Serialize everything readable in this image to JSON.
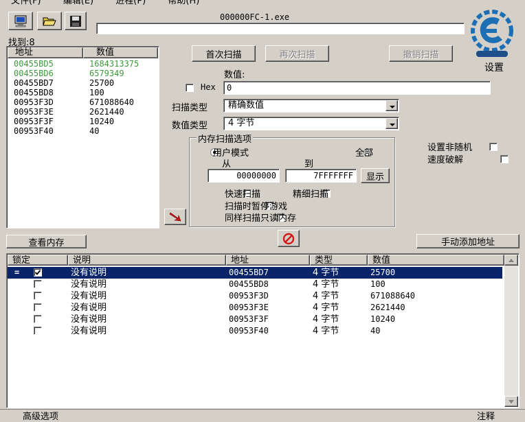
{
  "menu": [
    "文件(F)",
    "编辑(E)",
    "进程(P)",
    "帮助(H)"
  ],
  "process_name": "000000FC-1.exe",
  "found_label": "找到:8",
  "found_list": {
    "headers": [
      "地址",
      "数值"
    ],
    "rows": [
      {
        "address": "00455BD5",
        "value": "1684313375",
        "changed": true
      },
      {
        "address": "00455BD6",
        "value": "6579349",
        "changed": true
      },
      {
        "address": "00455BD7",
        "value": "25700",
        "changed": false
      },
      {
        "address": "00455BD8",
        "value": "100",
        "changed": false
      },
      {
        "address": "00953F3D",
        "value": "671088640",
        "changed": false
      },
      {
        "address": "00953F3E",
        "value": "2621440",
        "changed": false
      },
      {
        "address": "00953F3F",
        "value": "10240",
        "changed": false
      },
      {
        "address": "00953F40",
        "value": "40",
        "changed": false
      }
    ]
  },
  "scan": {
    "first_scan": "首次扫描",
    "next_scan": "再次扫描",
    "undo_scan": "撤销扫描",
    "settings": "设置",
    "value_label": "数值:",
    "hex_label": "Hex",
    "value_input": "0",
    "scan_type_label": "扫描类型",
    "scan_type_value": "精确数值",
    "value_type_label": "数值类型",
    "value_type_value": "4 字节"
  },
  "memory_options": {
    "title": "内存扫描选项",
    "user_mode": "用户模式",
    "all": "全部",
    "from_label": "从",
    "to_label": "到",
    "from_value": "00000000",
    "to_value": "7FFFFFFF",
    "show_button": "显示",
    "fast_scan": "快速扫描",
    "fine_scan": "精细扫描",
    "pause_game": "扫描时暂停游戏",
    "readonly_memory": "同样扫描只读内存"
  },
  "side_options": {
    "no_random": "设置非随机",
    "speedhack": "速度破解"
  },
  "view_memory": "查看内存",
  "add_address": "手动添加地址",
  "cheat_table": {
    "headers": [
      "锁定",
      "说明",
      "地址",
      "类型",
      "数值"
    ],
    "rows": [
      {
        "locked": true,
        "frozen_mark": "=",
        "desc": "没有说明",
        "address": "00455BD7",
        "type": "4 字节",
        "value": "25700",
        "selected": true
      },
      {
        "locked": false,
        "frozen_mark": "",
        "desc": "没有说明",
        "address": "00455BD8",
        "type": "4 字节",
        "value": "100",
        "selected": false
      },
      {
        "locked": false,
        "frozen_mark": "",
        "desc": "没有说明",
        "address": "00953F3D",
        "type": "4 字节",
        "value": "671088640",
        "selected": false
      },
      {
        "locked": false,
        "frozen_mark": "",
        "desc": "没有说明",
        "address": "00953F3E",
        "type": "4 字节",
        "value": "2621440",
        "selected": false
      },
      {
        "locked": false,
        "frozen_mark": "",
        "desc": "没有说明",
        "address": "00953F3F",
        "type": "4 字节",
        "value": "10240",
        "selected": false
      },
      {
        "locked": false,
        "frozen_mark": "",
        "desc": "没有说明",
        "address": "00953F40",
        "type": "4 字节",
        "value": "40",
        "selected": false
      }
    ]
  },
  "footer": {
    "advanced": "高级选项",
    "comments": "注释"
  },
  "colors": {
    "changed_value": "#3c9a3c",
    "selection": "#0a246a",
    "logo": "#1c6fb5"
  }
}
